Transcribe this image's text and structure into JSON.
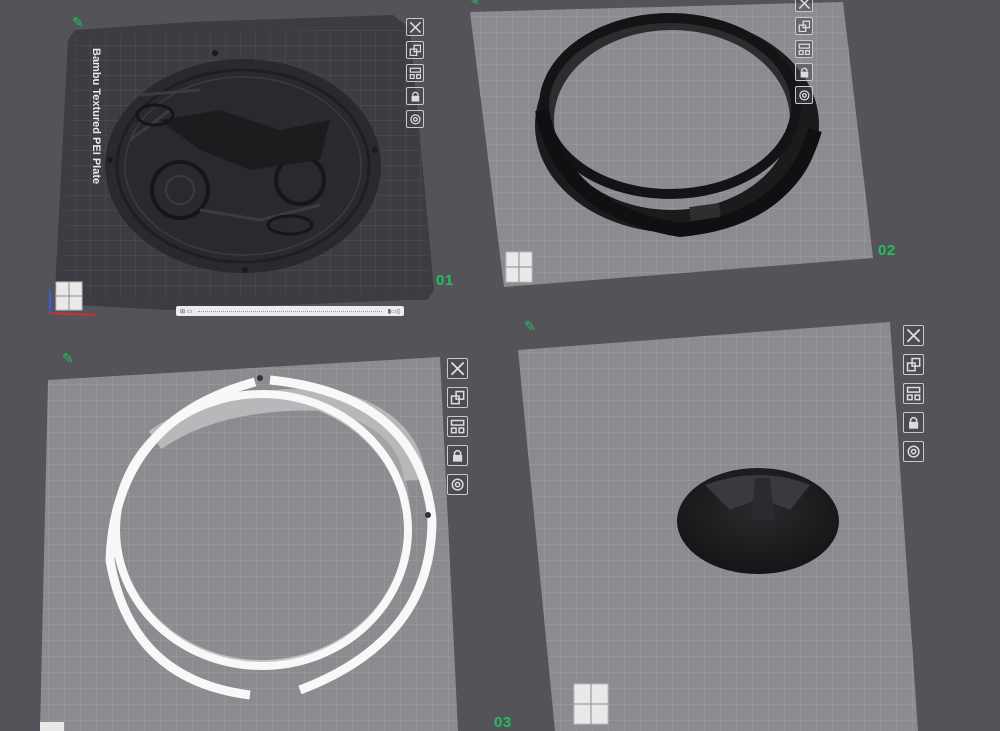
{
  "plates": [
    {
      "id": "plate-1",
      "label": "01",
      "bed_text": "Bambu Textured PEI Plate",
      "status_left": "⊞ ▭",
      "status_right": "▮▭▯"
    },
    {
      "id": "plate-2",
      "label": "02"
    },
    {
      "id": "plate-3",
      "label": "03"
    },
    {
      "id": "plate-4",
      "label": ""
    }
  ],
  "toolbar_icons": [
    "close-icon",
    "auto-orient-icon",
    "arrange-icon",
    "lock-icon",
    "settings-icon"
  ],
  "colors": {
    "background": "#545359",
    "bed_light": "#8b8b8f",
    "bed_dark": "#3c3c42",
    "grid_line": "#a5a5a9",
    "accent_green": "#1fc15a",
    "part_black": "#1e1e20",
    "part_white": "#f7f7f7"
  }
}
